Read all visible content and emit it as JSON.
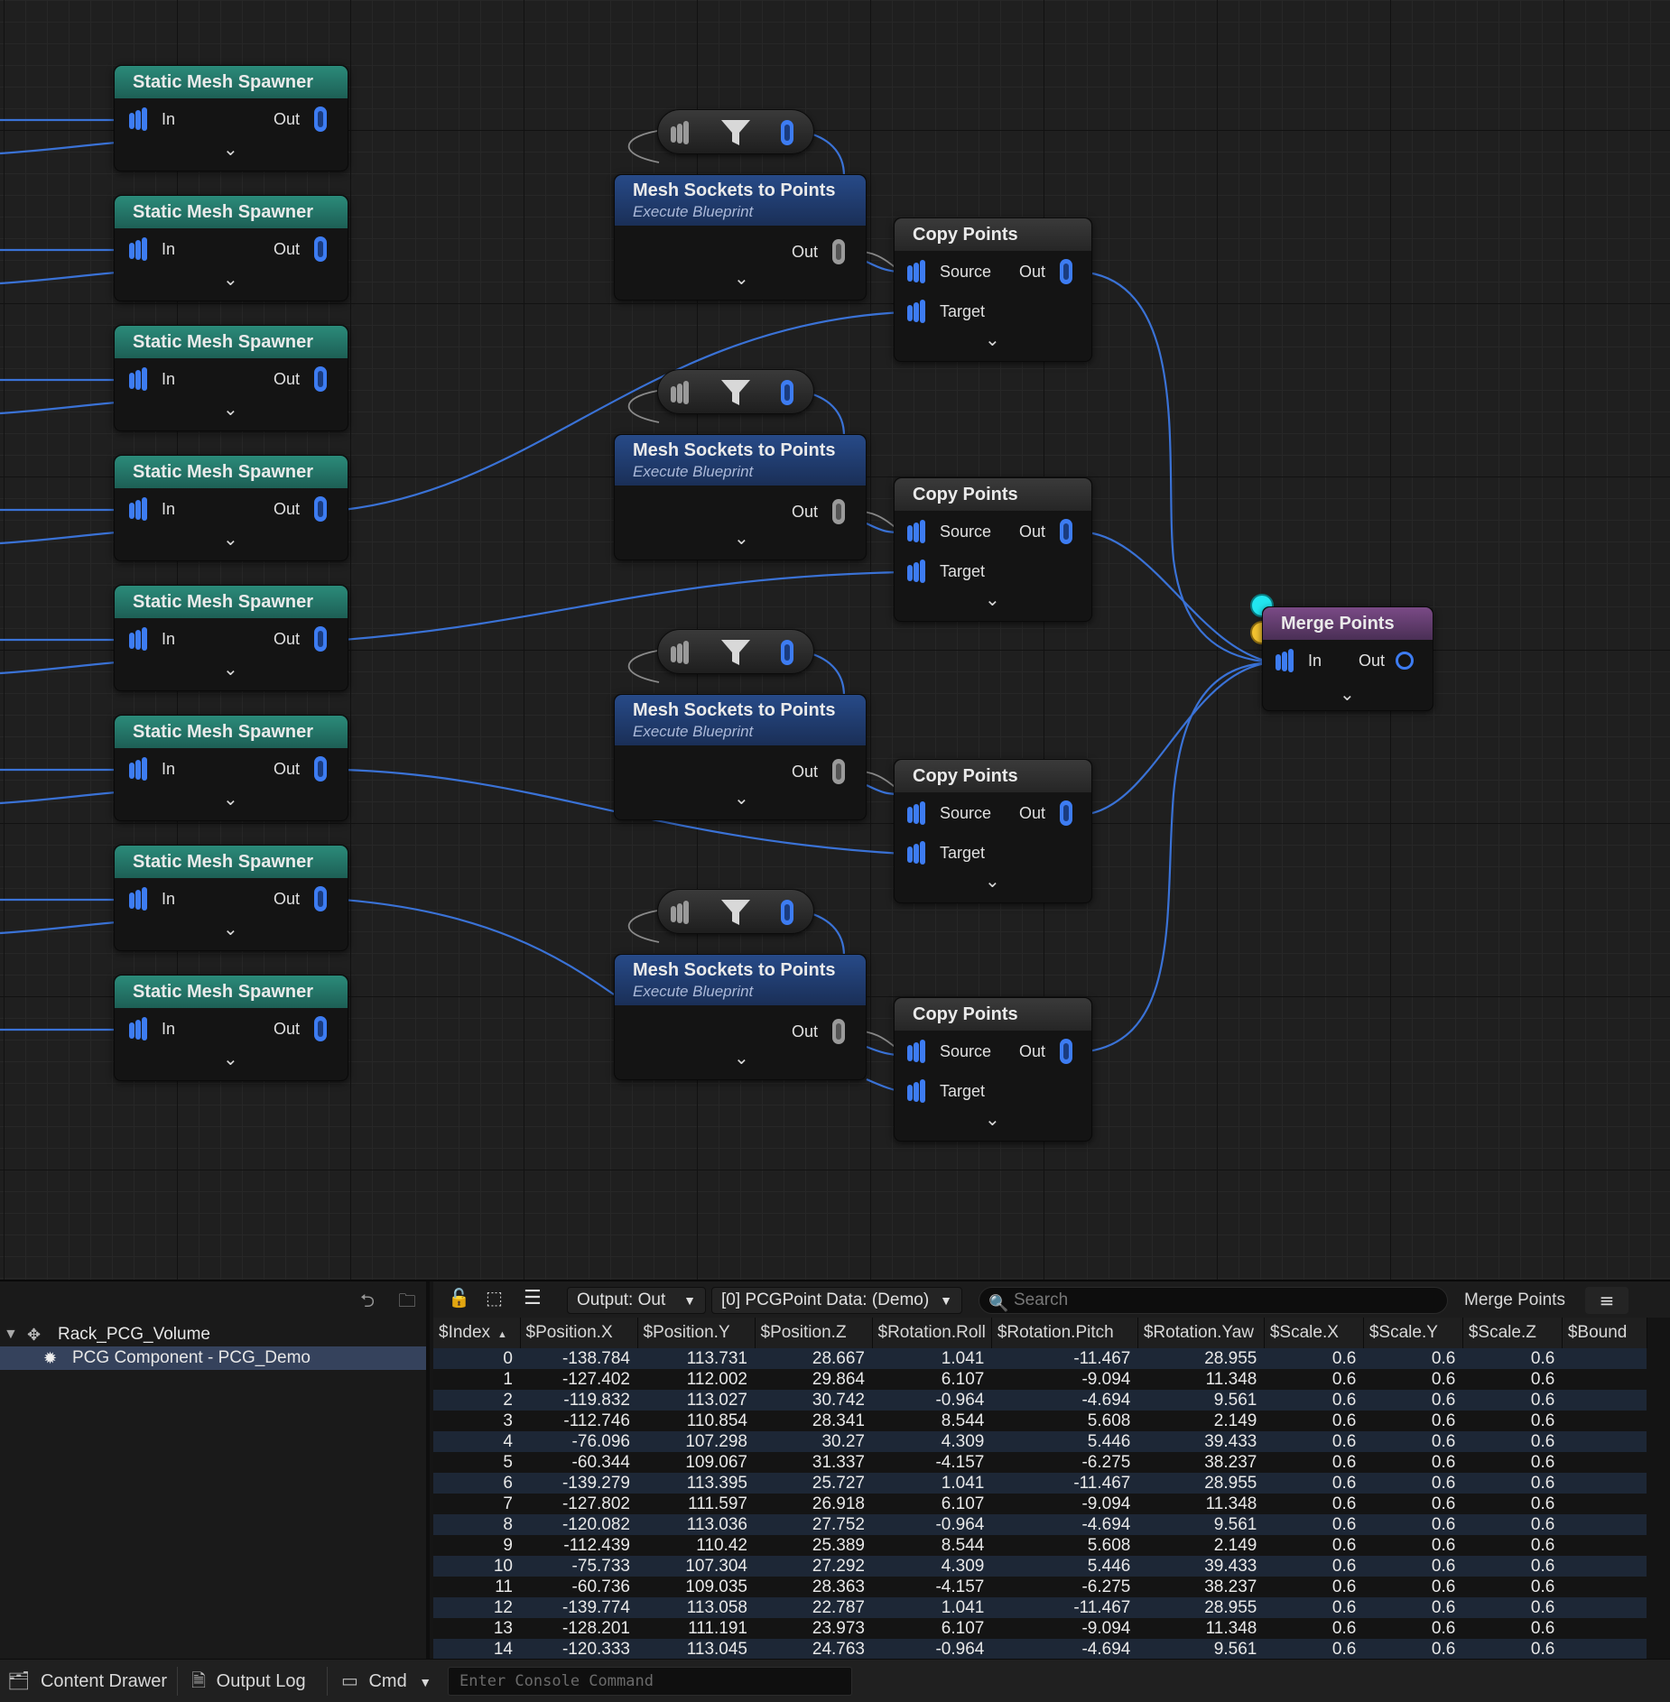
{
  "graph": {
    "spawner_title": "Static Mesh Spawner",
    "pin_in": "In",
    "pin_out": "Out",
    "sockets_title": "Mesh Sockets to Points",
    "sockets_subtitle": "Execute Blueprint",
    "copy_title": "Copy Points",
    "copy_source": "Source",
    "copy_target": "Target",
    "merge_title": "Merge Points"
  },
  "colors": {
    "wire": "#3a72d6",
    "spawner_header": "#2b8b7a",
    "sockets_header": "#274a88",
    "merge_header": "#7a4a86",
    "merge_dot_cyan": "#22e6f0",
    "merge_dot_yellow": "#f2c230"
  },
  "outliner": {
    "root": "Rack_PCG_Volume",
    "child": "PCG Component - PCG_Demo"
  },
  "datagrid": {
    "output_dropdown": "Output: Out",
    "data_dropdown": "[0] PCGPoint Data: (Demo)",
    "search_placeholder": "Search",
    "node_label": "Merge Points",
    "columns": [
      "$Index",
      "$Position.X",
      "$Position.Y",
      "$Position.Z",
      "$Rotation.Roll",
      "$Rotation.Pitch",
      "$Rotation.Yaw",
      "$Scale.X",
      "$Scale.Y",
      "$Scale.Z",
      "$Bound"
    ],
    "rows": [
      [
        "0",
        "-138.784",
        "113.731",
        "28.667",
        "1.041",
        "-11.467",
        "28.955",
        "0.6",
        "0.6",
        "0.6"
      ],
      [
        "1",
        "-127.402",
        "112.002",
        "29.864",
        "6.107",
        "-9.094",
        "11.348",
        "0.6",
        "0.6",
        "0.6"
      ],
      [
        "2",
        "-119.832",
        "113.027",
        "30.742",
        "-0.964",
        "-4.694",
        "9.561",
        "0.6",
        "0.6",
        "0.6"
      ],
      [
        "3",
        "-112.746",
        "110.854",
        "28.341",
        "8.544",
        "5.608",
        "2.149",
        "0.6",
        "0.6",
        "0.6"
      ],
      [
        "4",
        "-76.096",
        "107.298",
        "30.27",
        "4.309",
        "5.446",
        "39.433",
        "0.6",
        "0.6",
        "0.6"
      ],
      [
        "5",
        "-60.344",
        "109.067",
        "31.337",
        "-4.157",
        "-6.275",
        "38.237",
        "0.6",
        "0.6",
        "0.6"
      ],
      [
        "6",
        "-139.279",
        "113.395",
        "25.727",
        "1.041",
        "-11.467",
        "28.955",
        "0.6",
        "0.6",
        "0.6"
      ],
      [
        "7",
        "-127.802",
        "111.597",
        "26.918",
        "6.107",
        "-9.094",
        "11.348",
        "0.6",
        "0.6",
        "0.6"
      ],
      [
        "8",
        "-120.082",
        "113.036",
        "27.752",
        "-0.964",
        "-4.694",
        "9.561",
        "0.6",
        "0.6",
        "0.6"
      ],
      [
        "9",
        "-112.439",
        "110.42",
        "25.389",
        "8.544",
        "5.608",
        "2.149",
        "0.6",
        "0.6",
        "0.6"
      ],
      [
        "10",
        "-75.733",
        "107.304",
        "27.292",
        "4.309",
        "5.446",
        "39.433",
        "0.6",
        "0.6",
        "0.6"
      ],
      [
        "11",
        "-60.736",
        "109.035",
        "28.363",
        "-4.157",
        "-6.275",
        "38.237",
        "0.6",
        "0.6",
        "0.6"
      ],
      [
        "12",
        "-139.774",
        "113.058",
        "22.787",
        "1.041",
        "-11.467",
        "28.955",
        "0.6",
        "0.6",
        "0.6"
      ],
      [
        "13",
        "-128.201",
        "111.191",
        "23.973",
        "6.107",
        "-9.094",
        "11.348",
        "0.6",
        "0.6",
        "0.6"
      ],
      [
        "14",
        "-120.333",
        "113.045",
        "24.763",
        "-0.964",
        "-4.694",
        "9.561",
        "0.6",
        "0.6",
        "0.6"
      ]
    ]
  },
  "statusbar": {
    "content_drawer": "Content Drawer",
    "output_log": "Output Log",
    "cmd": "Cmd",
    "console_placeholder": "Enter Console Command"
  }
}
